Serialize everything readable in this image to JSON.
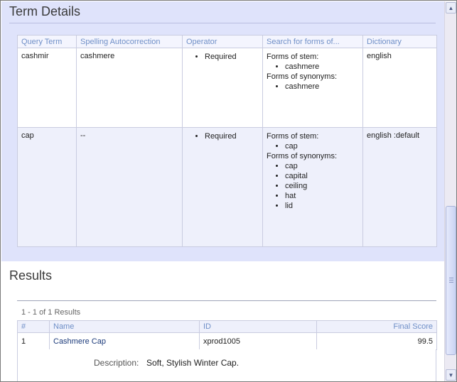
{
  "term_details": {
    "title": "Term Details",
    "headers": [
      "Query Term",
      "Spelling Autocorrection",
      "Operator",
      "Search for forms of...",
      "Dictionary"
    ],
    "rows": [
      {
        "query_term": "cashmir",
        "spelling": "cashmere",
        "operator": "Required",
        "stem_label": "Forms of stem:",
        "stem_forms": [
          "cashmere"
        ],
        "syn_label": "Forms of synonyms:",
        "syn_forms": [
          "cashmere"
        ],
        "dictionary": "english"
      },
      {
        "query_term": "cap",
        "spelling": "--",
        "operator": "Required",
        "stem_label": "Forms of stem:",
        "stem_forms": [
          "cap"
        ],
        "syn_label": "Forms of synonyms:",
        "syn_forms": [
          "cap",
          "capital",
          "ceiling",
          "hat",
          "lid"
        ],
        "dictionary": "english :default"
      }
    ]
  },
  "results": {
    "title": "Results",
    "count_text": "1 - 1 of 1 Results",
    "headers": [
      "#",
      "Name",
      "ID",
      "Final Score"
    ],
    "rows": [
      {
        "num": "1",
        "name": "Cashmere Cap",
        "id": "xprod1005",
        "score": "99.5"
      }
    ],
    "description_label": "Description:",
    "description_value": "Soft, Stylish Winter Cap."
  },
  "scrollbar": {
    "up_icon": "▲",
    "down_icon": "▼"
  }
}
